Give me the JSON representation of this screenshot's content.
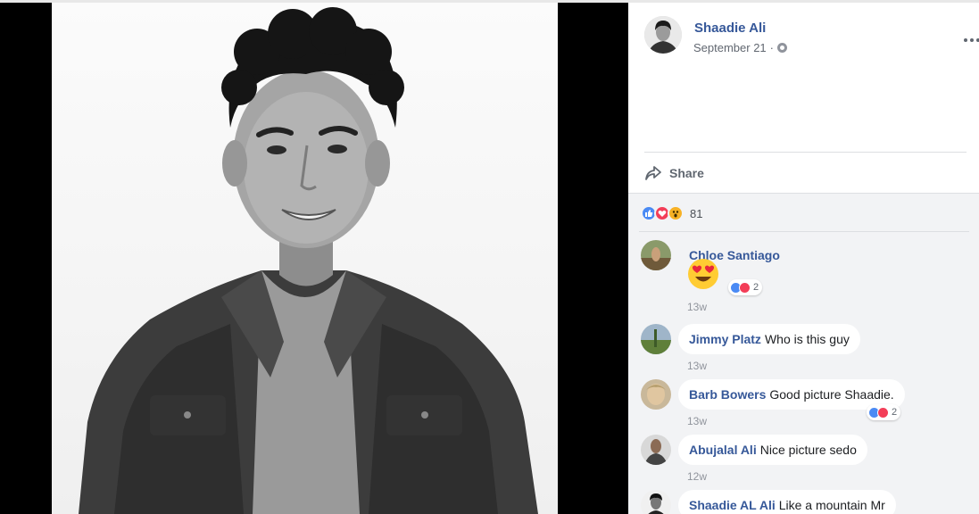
{
  "post": {
    "author": "Shaadie Ali",
    "date": "September 21",
    "separator": "·",
    "share_label": "Share",
    "reaction_count": "81"
  },
  "comments": [
    {
      "name": "Chloe Santiago",
      "text": "",
      "time": "13w",
      "reaction_count": "2"
    },
    {
      "name": "Jimmy Platz",
      "text": "Who is this guy",
      "time": "13w"
    },
    {
      "name": "Barb Bowers",
      "text": "Good picture Shaadie.",
      "time": "13w",
      "reaction_count": "2"
    },
    {
      "name": "Abujalal Ali",
      "text": "Nice picture sedo",
      "time": "12w"
    },
    {
      "name": "Shaadie AL Ali",
      "text": "Like a mountain Mr"
    }
  ],
  "colors": {
    "name_blue": "#365899",
    "like_blue": "#4a8af4",
    "love_red": "#f33e58",
    "wow_yellow": "#f7b125",
    "comment_bg": "#f2f3f5"
  }
}
